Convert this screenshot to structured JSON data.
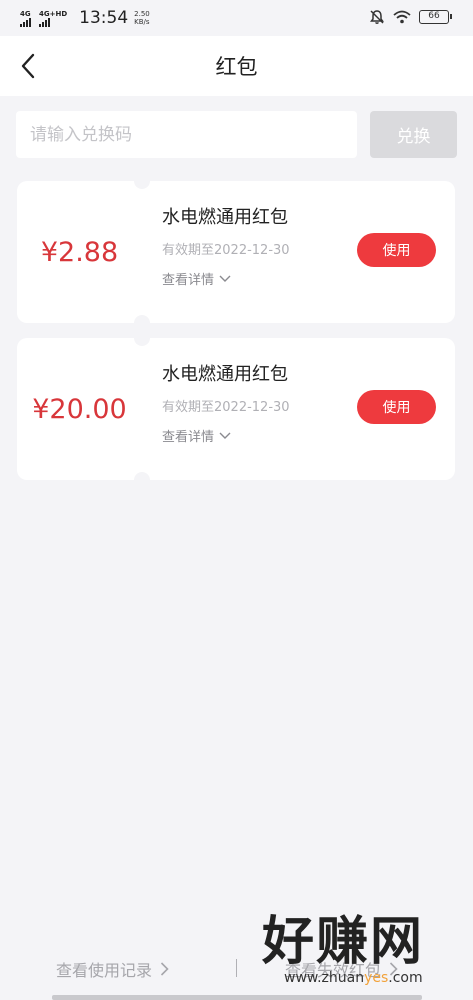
{
  "status_bar": {
    "network1": "4G",
    "network2": "4G+HD",
    "time": "13:54",
    "speed_value": "2.50",
    "speed_unit": "KB/s",
    "battery": "66"
  },
  "header": {
    "title": "红包"
  },
  "redeem": {
    "placeholder": "请输入兑换码",
    "button_label": "兑换"
  },
  "coupons": [
    {
      "amount": "¥2.88",
      "name": "水电燃通用红包",
      "expiry": "有效期至2022-12-30",
      "detail_label": "查看详情",
      "use_label": "使用"
    },
    {
      "amount": "¥20.00",
      "name": "水电燃通用红包",
      "expiry": "有效期至2022-12-30",
      "detail_label": "查看详情",
      "use_label": "使用"
    }
  ],
  "footer": {
    "records_label": "查看使用记录",
    "expired_label": "查看失效红包"
  },
  "watermark": {
    "brand": "好赚网",
    "url_prefix": "www.zhuan",
    "url_highlight": "yes",
    "url_suffix": ".com"
  },
  "colors": {
    "accent": "#ee3a3e",
    "amount": "#d8363a",
    "background": "#f4f4f7"
  }
}
